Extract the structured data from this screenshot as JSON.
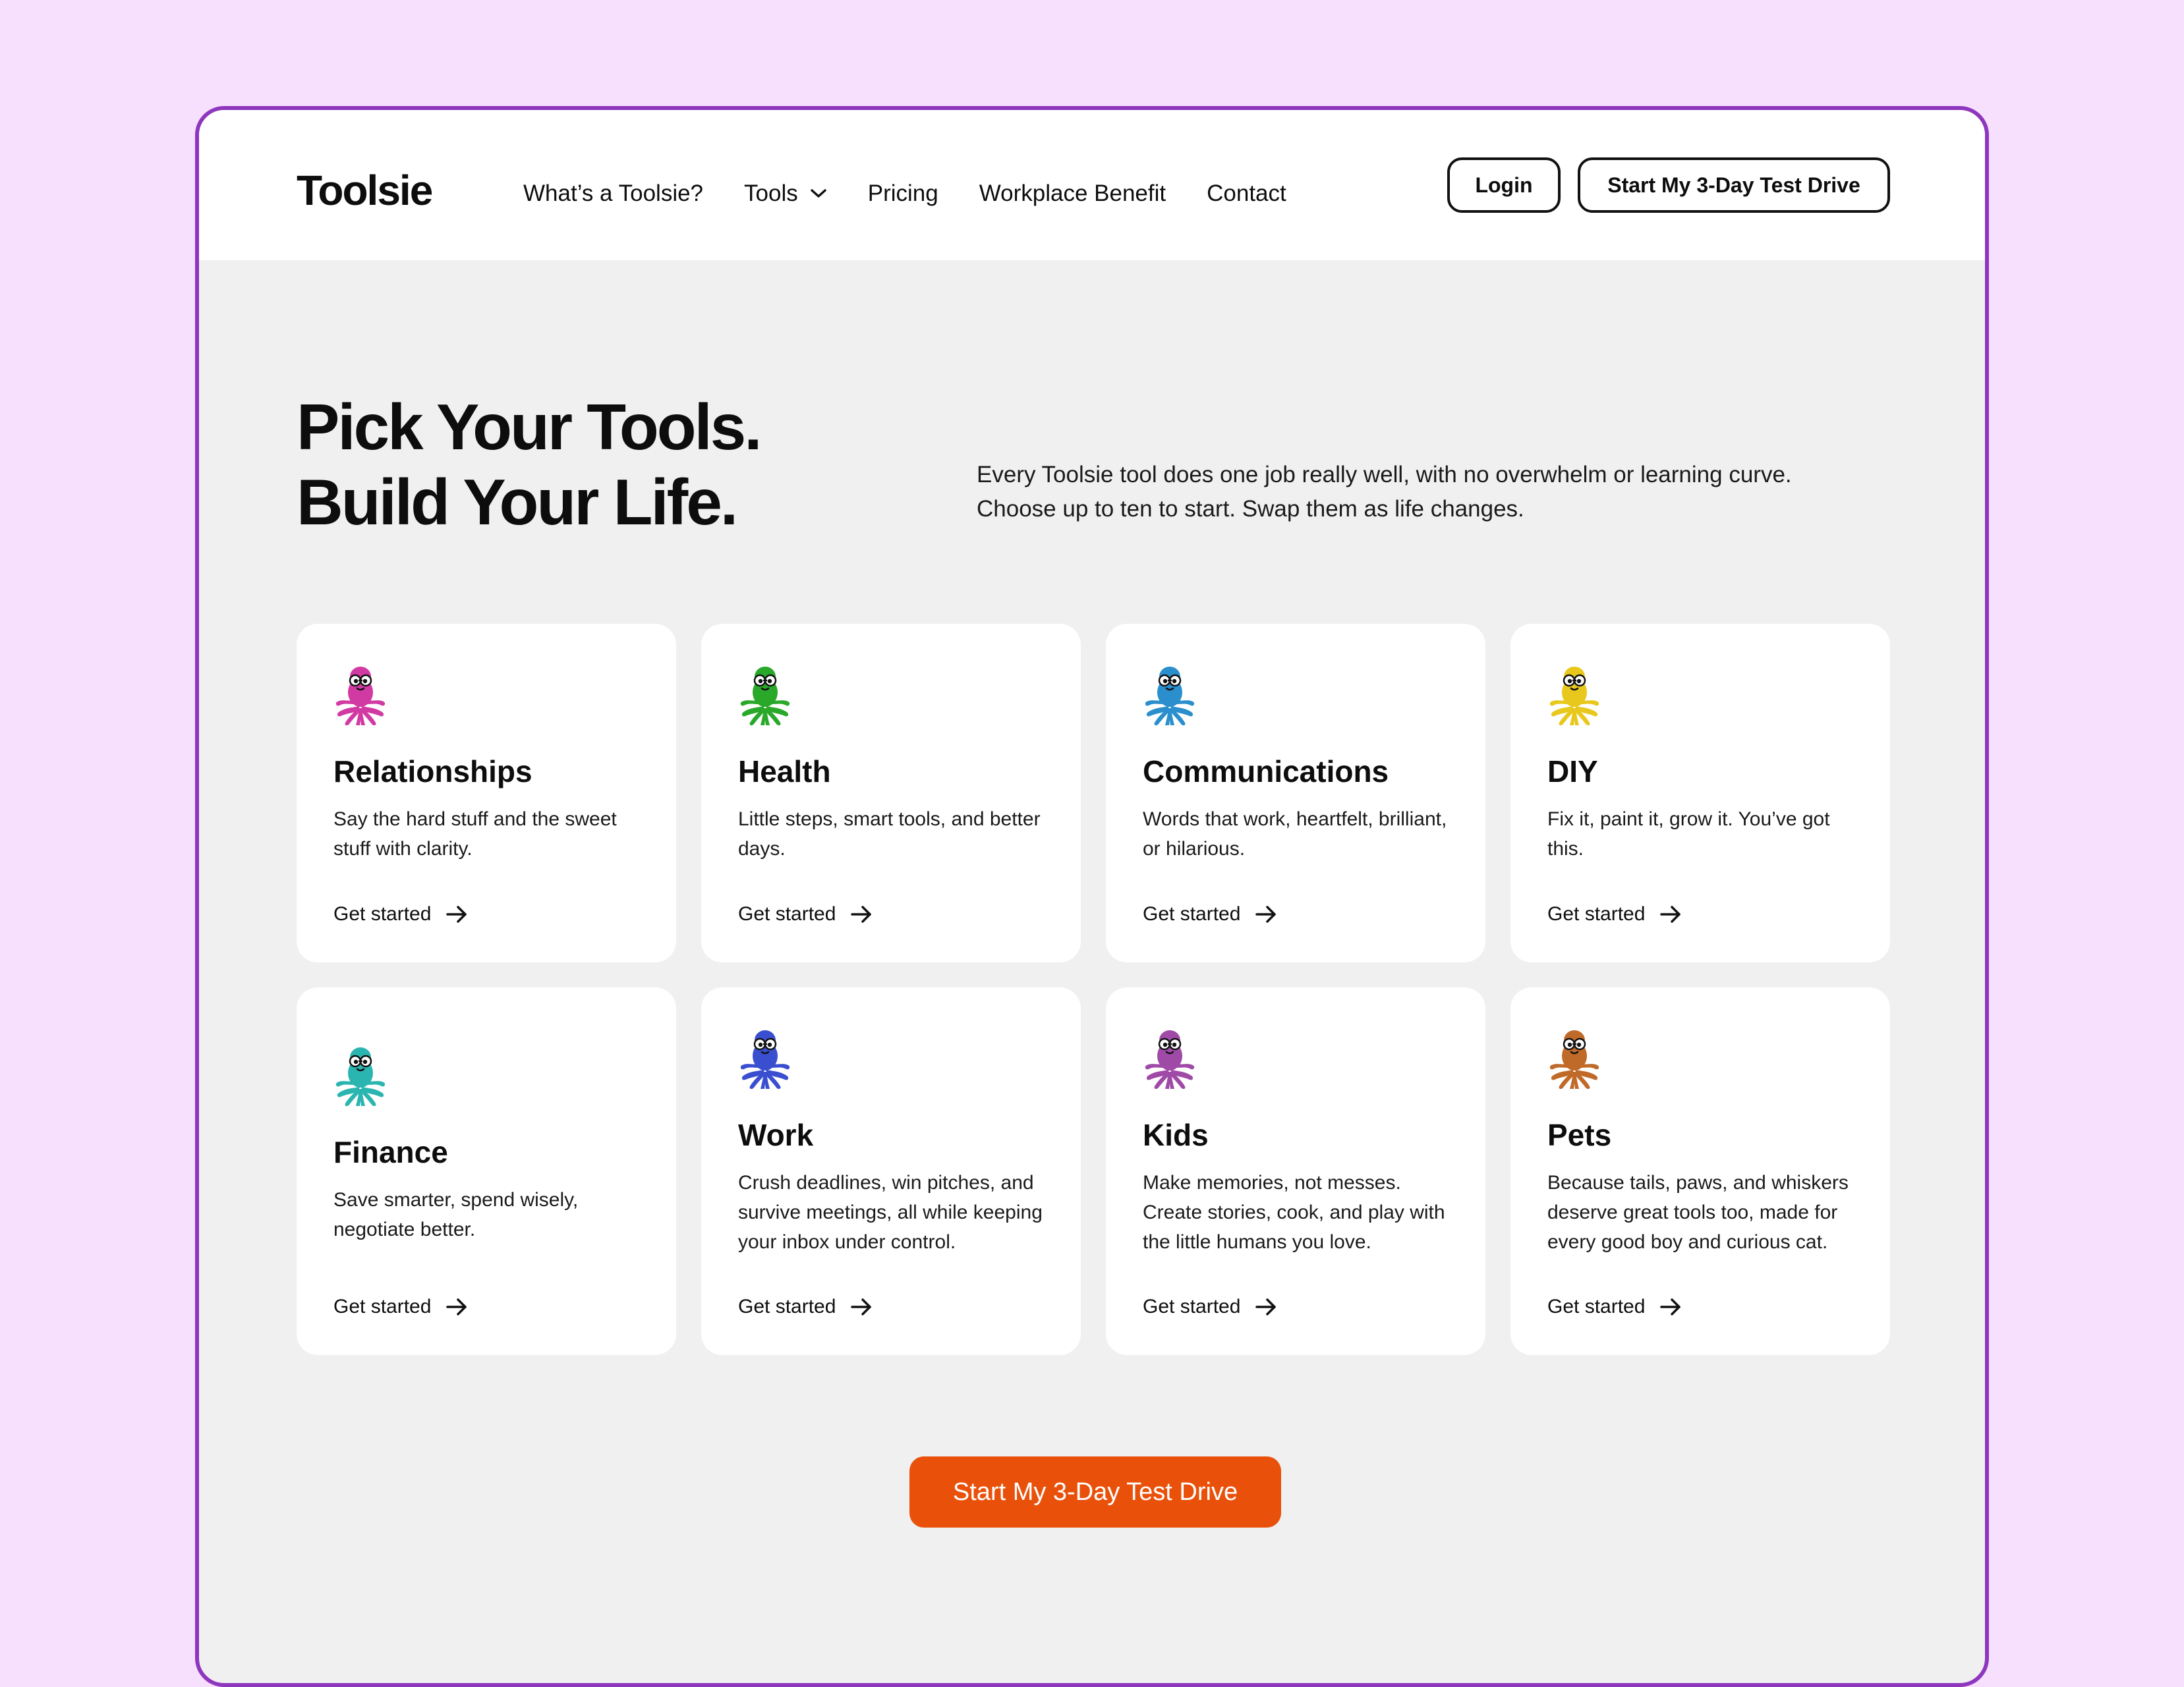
{
  "header": {
    "logo": "Toolsie",
    "nav": [
      {
        "label": "What’s a Toolsie?"
      },
      {
        "label": "Tools",
        "icon": "chevron-down-icon"
      },
      {
        "label": "Pricing"
      },
      {
        "label": "Workplace Benefit"
      },
      {
        "label": "Contact"
      }
    ],
    "login_label": "Login",
    "trial_label": "Start My 3-Day Test Drive"
  },
  "hero": {
    "title_line1": "Pick Your Tools.",
    "title_line2": "Build Your Life.",
    "description": "Every Toolsie tool does one job really well, with no overwhelm or learning curve.  Choose up to ten to start. Swap them as life changes."
  },
  "categories": [
    {
      "title": "Relationships",
      "desc": "Say the hard stuff and the sweet stuff with clarity.",
      "cta": "Get started",
      "color": "#d23aa3",
      "icon": "octopus-icon"
    },
    {
      "title": "Health",
      "desc": "Little steps, smart tools, and better days.",
      "cta": "Get started",
      "color": "#2aa82a",
      "icon": "octopus-icon"
    },
    {
      "title": "Communications",
      "desc": "Words that work, heartfelt, brilliant, or hilarious.",
      "cta": "Get started",
      "color": "#2a8fcc",
      "icon": "octopus-icon"
    },
    {
      "title": "DIY",
      "desc": "Fix it, paint it, grow it. You’ve got this.",
      "cta": "Get started",
      "color": "#e8c81c",
      "icon": "octopus-icon"
    },
    {
      "title": "Finance",
      "desc": "Save smarter, spend wisely, negotiate better.",
      "cta": "Get started",
      "color": "#2bb5b0",
      "icon": "octopus-icon"
    },
    {
      "title": "Work",
      "desc": "Crush deadlines, win pitches, and survive meetings, all while keeping your inbox under control.",
      "cta": "Get started",
      "color": "#3a4fd0",
      "icon": "octopus-icon"
    },
    {
      "title": "Kids",
      "desc": "Make memories, not messes. Create stories, cook, and play with the little humans you love.",
      "cta": "Get started",
      "color": "#a04aa8",
      "icon": "octopus-icon"
    },
    {
      "title": "Pets",
      "desc": "Because tails, paws, and whiskers deserve great tools too, made for every good boy and curious cat.",
      "cta": "Get started",
      "color": "#c06a2a",
      "icon": "octopus-icon"
    }
  ],
  "main_cta": "Start My 3-Day Test Drive",
  "colors": {
    "page_bg": "#f6e0fd",
    "frame_border": "#8e36be",
    "content_bg": "#f0f0f0",
    "cta_orange": "#e9510b"
  }
}
